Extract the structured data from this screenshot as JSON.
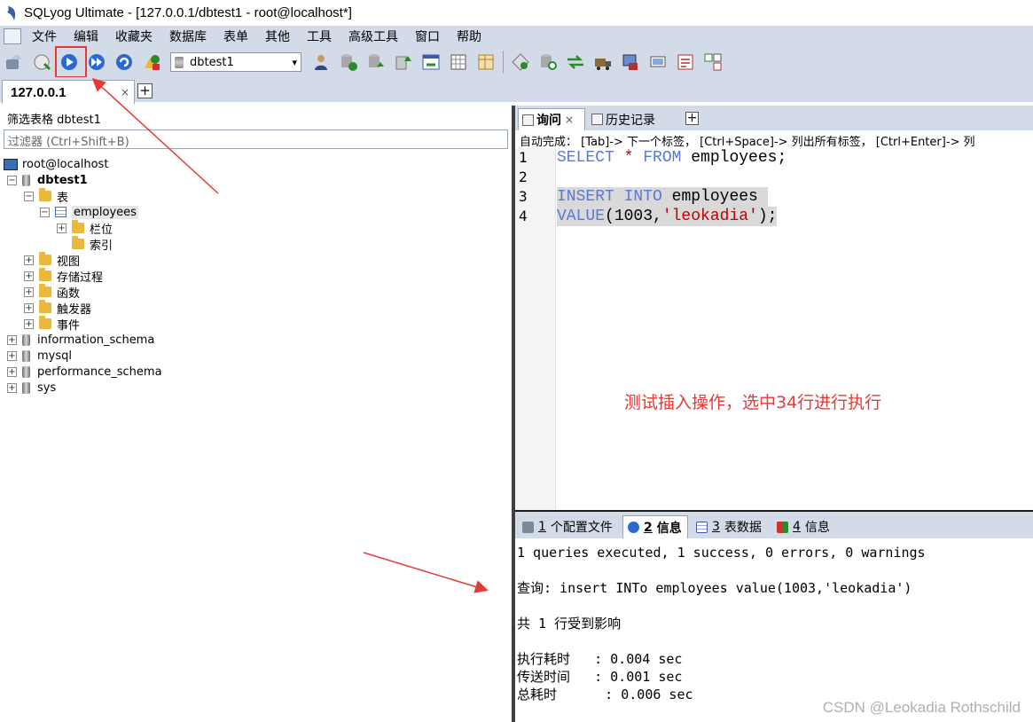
{
  "window": {
    "title": "SQLyog Ultimate - [127.0.0.1/dbtest1 - root@localhost*]"
  },
  "menu": {
    "items": [
      "文件",
      "编辑",
      "收藏夹",
      "数据库",
      "表单",
      "其他",
      "工具",
      "高级工具",
      "窗口",
      "帮助"
    ]
  },
  "toolbar": {
    "db_selected": "dbtest1"
  },
  "connection_tab": {
    "label": "127.0.0.1",
    "close": "×",
    "add": "+"
  },
  "object_browser": {
    "filter_label": "筛选表格 dbtest1",
    "filter_placeholder": "过滤器 (Ctrl+Shift+B)",
    "tree": {
      "root": "root@localhost",
      "db": "dbtest1",
      "tables_folder": "表",
      "table": "employees",
      "columns_folder": "栏位",
      "indexes_folder": "索引",
      "views": "视图",
      "procedures": "存储过程",
      "functions": "函数",
      "triggers": "触发器",
      "events": "事件",
      "other_dbs": [
        "information_schema",
        "mysql",
        "performance_schema",
        "sys"
      ]
    }
  },
  "query_tabs": {
    "query": "询问",
    "history": "历史记录"
  },
  "autocomplete_hint": "自动完成： [Tab]-> 下一个标签， [Ctrl+Space]-> 列出所有标签， [Ctrl+Enter]-> 列",
  "editor": {
    "line_numbers": [
      "1",
      "2",
      "3",
      "4"
    ],
    "line1": {
      "kw1": "SELECT",
      "op": " * ",
      "kw2": "FROM",
      "rest": " employees;"
    },
    "line3": {
      "kw1": "INSERT",
      "sp": " ",
      "kw2": "INTO",
      "rest": " employees "
    },
    "line4": {
      "kw": "VALUE",
      "p1": "(1003,",
      "str": "'leokadia'",
      "p2": ");"
    }
  },
  "annotation": "测试插入操作，选中34行进行执行",
  "result_tabs": {
    "tab1_num": "1",
    "tab1_label": "个配置文件",
    "tab2_num": "2",
    "tab2_label": "信息",
    "tab3_num": "3",
    "tab3_label": "表数据",
    "tab4_num": "4",
    "tab4_label": "信息"
  },
  "messages": {
    "summary": "1 queries executed, 1 success, 0 errors, 0 warnings",
    "query": "查询: insert INTo employees value(1003,'leokadia')",
    "affected": "共 1 行受到影响",
    "exec_time": "执行耗时   : 0.004 sec",
    "transfer_time": "传送时间   : 0.001 sec",
    "total_time": "总耗时      : 0.006 sec"
  },
  "watermark": "CSDN @Leokadia Rothschild",
  "colors": {
    "keyword": "#5a78d6",
    "string": "#c00000",
    "annotation": "#e53935",
    "chrome": "#d4dbe8"
  }
}
